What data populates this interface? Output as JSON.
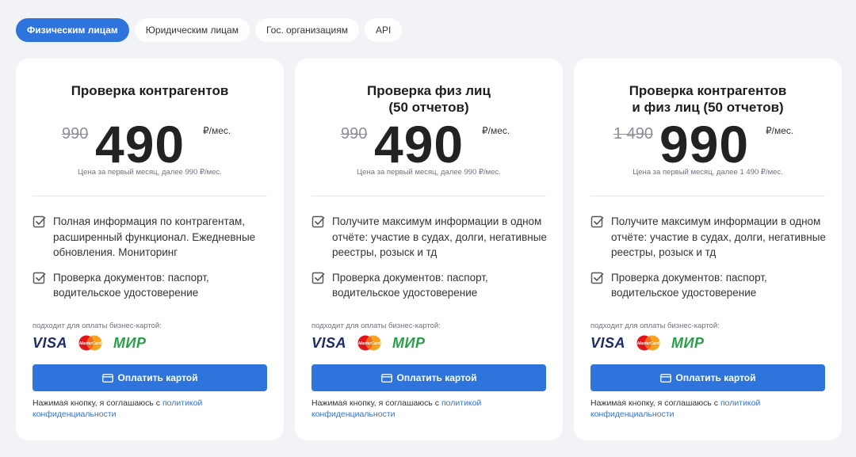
{
  "tabs": [
    {
      "label": "Физическим лицам",
      "active": true
    },
    {
      "label": "Юридическим лицам",
      "active": false
    },
    {
      "label": "Гос. организациям",
      "active": false
    },
    {
      "label": "API",
      "active": false
    }
  ],
  "cards": [
    {
      "title": "Проверка контрагентов",
      "old_price": "990",
      "price": "490",
      "unit": "₽/мес.",
      "note": "Цена за первый месяц, далее 990 ₽/мес.",
      "features": [
        "Полная информация по контрагентам, расширенный функционал. Ежедневные обновления. Мониторинг",
        "Проверка документов: паспорт, водительское удостоверение"
      ],
      "pay_note": "подходит для оплаты бизнес-картой:",
      "button_label": "Оплатить картой",
      "agree_text": "Нажимая кнопку, я соглашаюсь с ",
      "agree_link": "политикой конфиденциальности"
    },
    {
      "title": "Проверка физ лиц\n(50 отчетов)",
      "old_price": "990",
      "price": "490",
      "unit": "₽/мес.",
      "note": "Цена за первый месяц, далее 990 ₽/мес.",
      "features": [
        "Получите максимум информации в одном отчёте: участие в судах, долги, негативные реестры, розыск и тд",
        "Проверка документов: паспорт, водительское удостоверение"
      ],
      "pay_note": "подходит для оплаты бизнес-картой:",
      "button_label": "Оплатить картой",
      "agree_text": "Нажимая кнопку, я соглашаюсь с ",
      "agree_link": "политикой конфиденциальности"
    },
    {
      "title": "Проверка контрагентов\nи физ лиц (50 отчетов)",
      "old_price": "1 490",
      "price": "990",
      "unit": "₽/мес.",
      "note": "Цена за первый месяц, далее 1 490 ₽/мес.",
      "features": [
        "Получите максимум информации в одном отчёте: участие в судах, долги, негативные реестры, розыск и тд",
        "Проверка документов: паспорт, водительское удостоверение"
      ],
      "pay_note": "подходит для оплаты бизнес-картой:",
      "button_label": "Оплатить картой",
      "agree_text": "Нажимая кнопку, я соглашаюсь с ",
      "agree_link": "политикой конфиденциальности"
    }
  ],
  "logos": {
    "visa": "VISA",
    "mastercard": "MasterCard",
    "mir": "МИР"
  },
  "icons": {
    "check": "checkbox-check-icon",
    "card": "credit-card-icon"
  },
  "colors": {
    "accent": "#2f73dc",
    "background": "#f1f3f7",
    "card": "#ffffff"
  }
}
